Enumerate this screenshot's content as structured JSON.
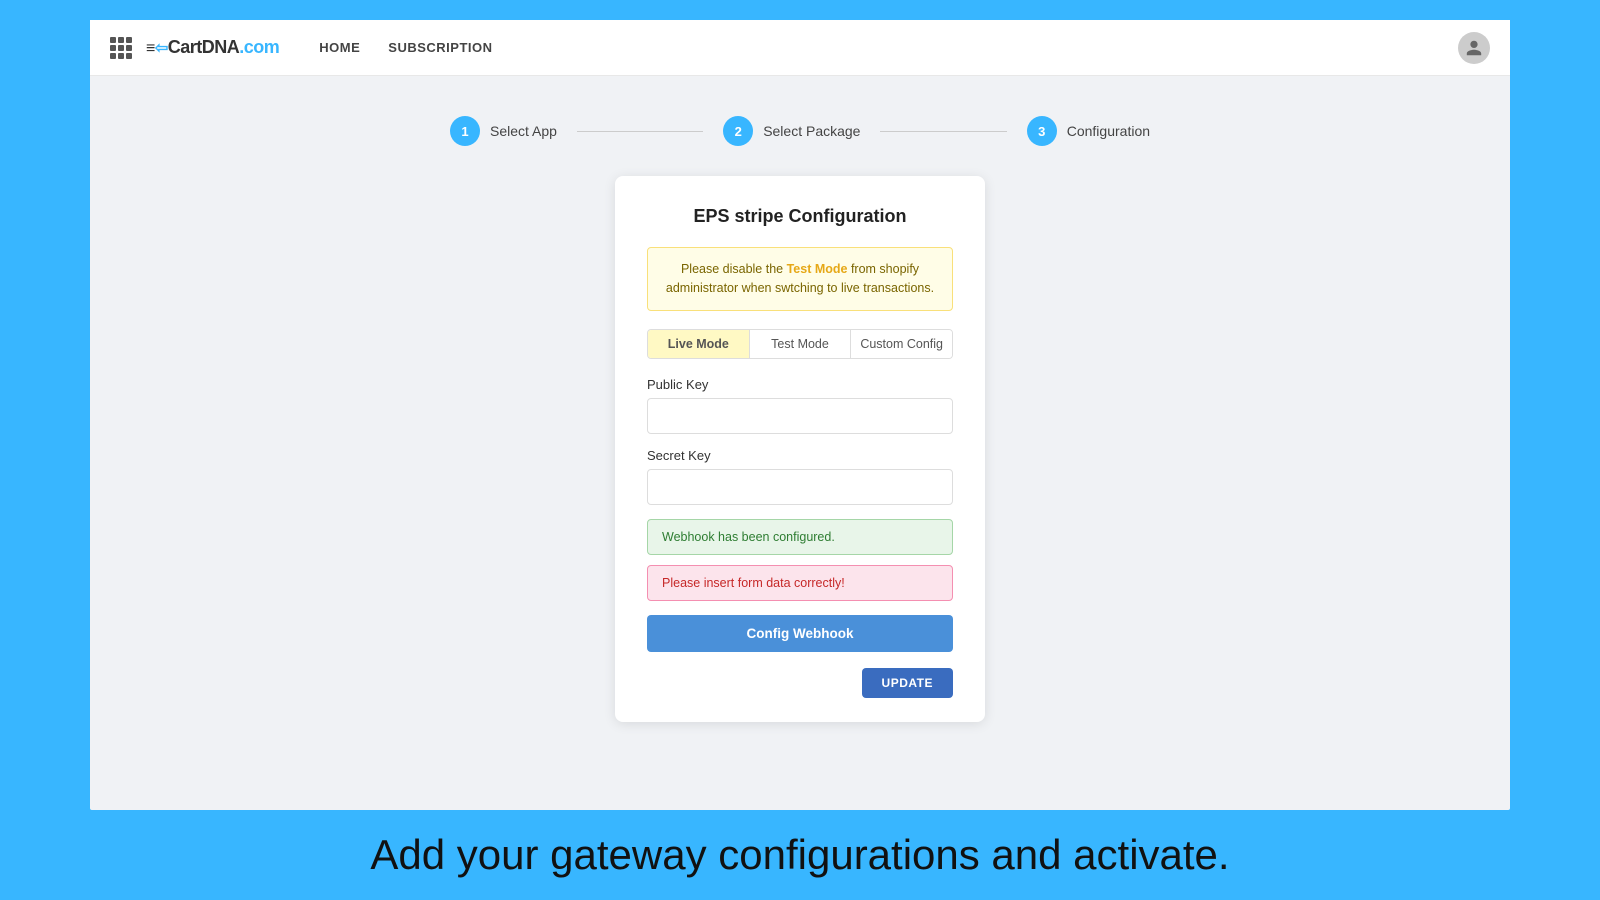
{
  "navbar": {
    "brand": "≡CartDNA.com",
    "nav_links": [
      "HOME",
      "SUBSCRIPTION"
    ]
  },
  "stepper": {
    "steps": [
      {
        "number": "1",
        "label": "Select App"
      },
      {
        "number": "2",
        "label": "Select Package"
      },
      {
        "number": "3",
        "label": "Configuration"
      }
    ]
  },
  "card": {
    "title": "EPS stripe Configuration",
    "warning_text_1": "Please disable the ",
    "warning_highlight": "Test Mode",
    "warning_text_2": " from shopify",
    "warning_text_3": "administrator when swtching to live transactions.",
    "tabs": [
      "Live Mode",
      "Test Mode",
      "Custom Config"
    ],
    "active_tab": 0,
    "public_key_label": "Public Key",
    "public_key_placeholder": "",
    "secret_key_label": "Secret Key",
    "secret_key_placeholder": "",
    "success_message": "Webhook has been configured.",
    "error_message": "Please insert form data correctly!",
    "config_webhook_btn": "Config Webhook",
    "update_btn": "UPDATE"
  },
  "caption": {
    "text": "Add your gateway configurations and activate."
  }
}
